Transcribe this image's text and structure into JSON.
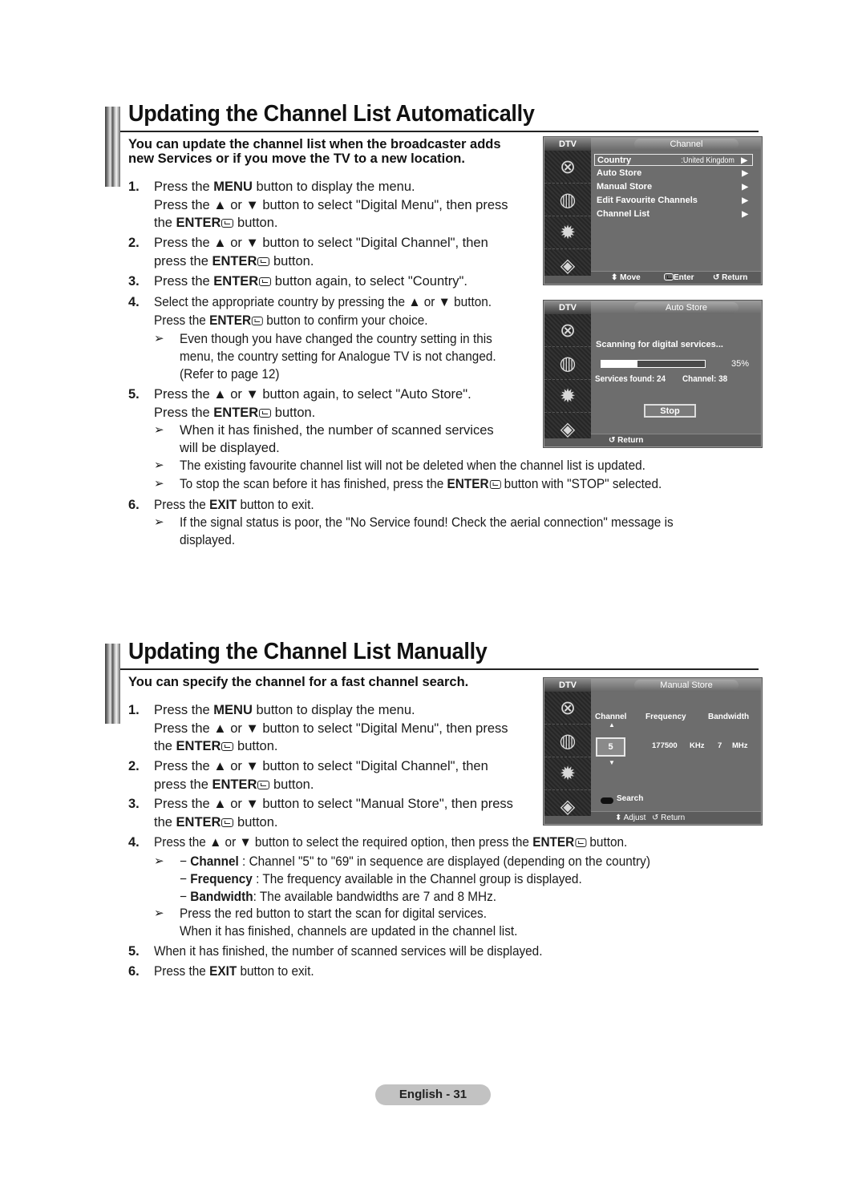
{
  "section1": {
    "title": "Updating the Channel List Automatically",
    "intro_line1": "You can update the channel list when the broadcaster adds",
    "intro_line2": "new Services or if you move the TV to a new location.",
    "steps": [
      {
        "num": "1.",
        "lines": [
          "Press the <b>MENU</b> button to display the menu.",
          "Press the ▲ or ▼ button to select \"Digital Menu\", then press",
          "the <b>ENTER</b>{E} button."
        ]
      },
      {
        "num": "2.",
        "lines": [
          "Press the ▲ or ▼ button to select \"Digital Channel\", then",
          "press the <b>ENTER</b>{E} button."
        ]
      },
      {
        "num": "3.",
        "lines": [
          "Press the <b>ENTER</b>{E} button again, to select \"Country\"."
        ]
      },
      {
        "num": "4.",
        "lines": [
          "Select the appropriate country by pressing the ▲ or ▼ button.",
          "Press the <b>ENTER</b>{E} button to confirm your choice."
        ]
      },
      {
        "num": "5.",
        "lines": [
          "Press the ▲ or ▼ button again, to select \"Auto Store\".",
          "Press the <b>ENTER</b>{E} button."
        ]
      },
      {
        "num": "6.",
        "lines": [
          "Press the <b>EXIT</b> button to exit."
        ]
      }
    ],
    "notes": [
      {
        "lines": [
          "Even though you have changed the country setting in this",
          "menu, the country setting for Analogue TV is not changed.",
          "(Refer to page 12)"
        ]
      },
      {
        "lines": [
          "When it has finished, the number of scanned services",
          "will be displayed."
        ]
      },
      {
        "lines": [
          "The existing favourite channel list will not be deleted when the channel list is updated."
        ]
      },
      {
        "lines": [
          "To stop the scan before it has finished, press the <b>ENTER</b>{E} button with \"STOP\" selected."
        ]
      },
      {
        "lines": [
          "If the signal status is poor, the \"No Service found! Check the aerial connection\" message is",
          "displayed."
        ]
      }
    ]
  },
  "section2": {
    "title": "Updating the Channel List Manually",
    "intro": "You can specify the channel for a fast channel search.",
    "steps": [
      {
        "num": "1.",
        "lines": [
          "Press the <b>MENU</b> button to display the menu.",
          "Press the ▲ or ▼ button to select \"Digital Menu\", then press",
          "the <b>ENTER</b>{E} button."
        ]
      },
      {
        "num": "2.",
        "lines": [
          "Press the ▲ or ▼ button to select \"Digital Channel\", then",
          "press the <b>ENTER</b>{E} button."
        ]
      },
      {
        "num": "3.",
        "lines": [
          "Press the ▲ or ▼ button to select \"Manual Store\", then press",
          "the <b>ENTER</b>{E} button."
        ]
      },
      {
        "num": "4.",
        "lines": [
          "Press the ▲ or ▼ button to select the required option, then press the <b>ENTER</b>{E} button."
        ]
      },
      {
        "num": "5.",
        "lines": [
          "When it has finished, the number of scanned services will be displayed."
        ]
      },
      {
        "num": "6.",
        "lines": [
          "Press the <b>EXIT</b> button to exit."
        ]
      }
    ],
    "notes": [
      {
        "lines": [
          "− <b>Channel</b> : Channel \"5\" to \"69\" in sequence are displayed (depending on the country)",
          "− <b>Frequency</b> : The frequency available in the Channel group is displayed.",
          "−  <b>Bandwidth</b>: The available bandwidths are 7 and 8 MHz."
        ]
      },
      {
        "lines": [
          "Press the red button to start the scan for digital services.",
          "When it has finished, channels are updated in the channel list."
        ]
      }
    ]
  },
  "osd_channel": {
    "dtv": "DTV",
    "title": "Channel",
    "items": [
      {
        "label": "Country",
        "value": ":United Kingdom",
        "arrow": "▶"
      },
      {
        "label": "Auto Store",
        "value": "",
        "arrow": "▶"
      },
      {
        "label": "Manual Store",
        "value": "",
        "arrow": "▶"
      },
      {
        "label": "Edit Favourite Channels",
        "value": "",
        "arrow": "▶"
      },
      {
        "label": "Channel List",
        "value": "",
        "arrow": "▶"
      }
    ],
    "footer": {
      "move": "⬍ Move",
      "enter": "Enter",
      "return": "↺ Return"
    }
  },
  "osd_auto": {
    "dtv": "DTV",
    "title": "Auto Store",
    "scanning": "Scanning for digital services...",
    "progress_percent": 35,
    "progress_label": "35%",
    "services_found": "Services found: 24",
    "channel": "Channel: 38",
    "stop": "Stop",
    "footer_return": "↺ Return"
  },
  "osd_manual": {
    "dtv": "DTV",
    "title": "Manual Store",
    "col_channel": "Channel",
    "col_frequency": "Frequency",
    "col_bandwidth": "Bandwidth",
    "channel_value": "5",
    "frequency_value": "177500",
    "frequency_unit": "KHz",
    "bandwidth_value": "7",
    "bandwidth_unit": "MHz",
    "up": "▲",
    "down": "▼",
    "search": "Search",
    "footer_adjust": "⬍ Adjust",
    "footer_return": "↺ Return"
  },
  "osd_icons": [
    "picture-icon",
    "sound-icon",
    "setup-icon",
    "input-icon"
  ],
  "footer": {
    "page_label": "English - 31"
  }
}
